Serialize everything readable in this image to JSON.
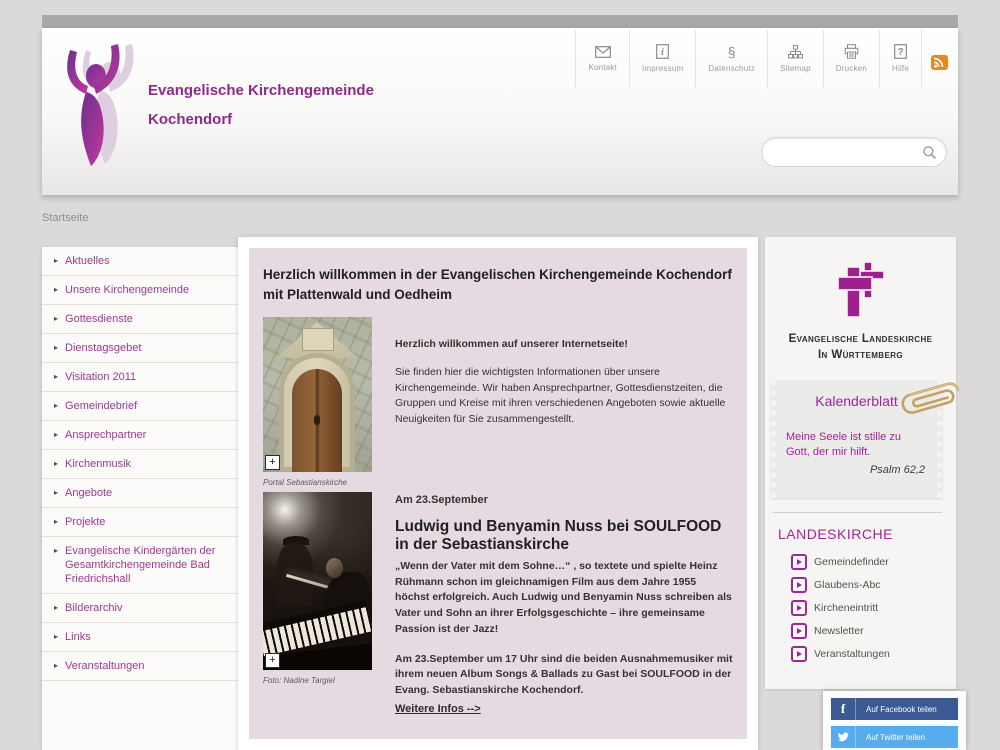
{
  "brand": {
    "title_line1": "Evangelische Kirchengemeinde",
    "title_line2": "Kochendorf"
  },
  "header_nav": {
    "items": [
      {
        "label": "Kontakt",
        "icon": "mail-icon"
      },
      {
        "label": "Impressum",
        "icon": "info-icon"
      },
      {
        "label": "Datenschutz",
        "icon": "paragraph-icon"
      },
      {
        "label": "Sitemap",
        "icon": "sitemap-icon"
      },
      {
        "label": "Drucken",
        "icon": "printer-icon"
      },
      {
        "label": "Hilfe",
        "icon": "help-icon"
      }
    ],
    "rss_icon": "rss-icon",
    "paragraph_glyph": "§"
  },
  "search": {
    "value": ""
  },
  "breadcrumb": {
    "label": "Startseite"
  },
  "sidebar": {
    "items": [
      {
        "label": "Aktuelles"
      },
      {
        "label": "Unsere Kirchengemeinde"
      },
      {
        "label": "Gottesdienste"
      },
      {
        "label": "Dienstagsgebet"
      },
      {
        "label": "Visitation 2011"
      },
      {
        "label": "Gemeindebrief"
      },
      {
        "label": "Ansprechpartner"
      },
      {
        "label": "Kirchenmusik"
      },
      {
        "label": "Angebote"
      },
      {
        "label": "Projekte"
      },
      {
        "label": "Evangelische Kindergärten der Gesamtkirchengemeinde Bad Friedrichshall"
      },
      {
        "label": "Bilderarchiv"
      },
      {
        "label": "Links"
      },
      {
        "label": "Veranstaltungen"
      }
    ],
    "bullet": "▸"
  },
  "main": {
    "heading": "Herzlich willkommen in der Evangelischen Kirchengemeinde Kochendorf mit Plattenwald und Oedheim",
    "welcome_bold": "Herzlich willkommen auf unserer Internetseite!",
    "welcome_text": "Sie finden hier die wichtigsten Informationen über unsere Kirchengemeinde. Wir haben Ansprechpartner, Gottesdienstzeiten, die Gruppen und Kreise mit ihren verschiedenen Angeboten sowie aktuelle Neuigkeiten für Sie zusammengestellt.",
    "portal_caption": "Portal Sebastianskirche",
    "event_date": "Am 23.September",
    "event_heading": "Ludwig und Benyamin Nuss bei SOULFOOD in der Sebastianskirche",
    "event_text1": "„Wenn der Vater mit dem Sohne…“ , so textete und spielte Heinz Rühmann schon im gleichnamigen Film aus dem Jahre 1955 höchst erfolgreich. Auch Ludwig und Benyamin Nuss schreiben als Vater und Sohn an ihrer Erfolgsgeschichte – ihre gemeinsame Passion ist der Jazz!",
    "event_text2": "Am 23.September um 17 Uhr sind die beiden Ausnahmemusiker mit ihrem neuen Album Songs & Ballads zu Gast bei SOULFOOD in der Evang. Sebastianskirche Kochendorf.",
    "event_link": "Weitere Infos -->",
    "photo_caption": "Foto: Nadine Targiel",
    "zoom_symbol": "+"
  },
  "right": {
    "landeskirche_name_line1": "Evangelische Landeskirche",
    "landeskirche_name_line2": "In Württemberg",
    "kalender": {
      "title": "Kalenderblatt",
      "verse": "Meine Seele ist stille zu Gott, der mir hilft.",
      "source": "Psalm 62,2"
    },
    "links_heading": "LANDESKIRCHE",
    "links": [
      {
        "label": "Gemeindefinder"
      },
      {
        "label": "Glaubens-Abc"
      },
      {
        "label": "Kircheneintritt"
      },
      {
        "label": "Newsletter"
      },
      {
        "label": "Veranstaltungen"
      }
    ]
  },
  "share": {
    "facebook_label": "Auf Facebook teilen",
    "twitter_label": "Auf Twitter teilen"
  },
  "colors": {
    "accent_magenta": "#9c2190",
    "sidebar_link": "#9a3a95",
    "content_pink": "#e5d9e2",
    "facebook_blue": "#3b5a94",
    "twitter_blue": "#56aced",
    "rss_orange": "#e8891d"
  }
}
